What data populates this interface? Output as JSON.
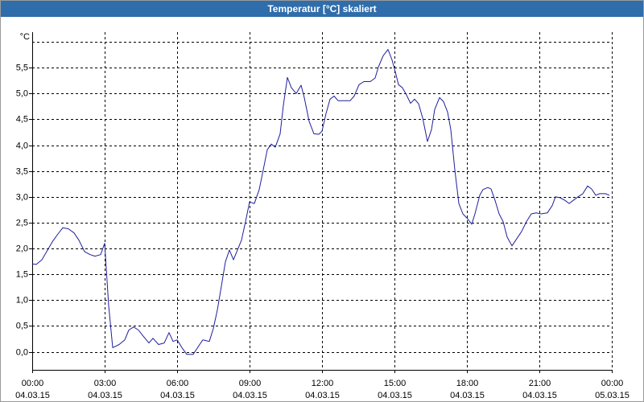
{
  "colors": {
    "title_bar": "#2f6dab",
    "title_text": "#ffffff",
    "series_line": "#1f1f9c",
    "grid": "#000000",
    "background": "#ffffff"
  },
  "chart_data": {
    "type": "line",
    "title": "Temperatur [°C] skaliert",
    "xlabel": "",
    "ylabel": "°C",
    "xlim": [
      "04.03.15 00:00",
      "05.03.15 00:00"
    ],
    "ylim": [
      -0.35,
      6.0
    ],
    "grid": true,
    "legend": "none",
    "yticks": [
      0.0,
      0.5,
      1.0,
      1.5,
      2.0,
      2.5,
      3.0,
      3.5,
      4.0,
      4.5,
      5.0,
      5.5
    ],
    "ytick_labels": [
      "0,0",
      "0,5",
      "1,0",
      "1,5",
      "2,0",
      "2,5",
      "3,0",
      "3,5",
      "4,0",
      "4,5",
      "5,0",
      "5,5"
    ],
    "xticks": [
      {
        "time": "00:00",
        "date": "04.03.15"
      },
      {
        "time": "03:00",
        "date": "04.03.15"
      },
      {
        "time": "06:00",
        "date": "04.03.15"
      },
      {
        "time": "09:00",
        "date": "04.03.15"
      },
      {
        "time": "12:00",
        "date": "04.03.15"
      },
      {
        "time": "15:00",
        "date": "04.03.15"
      },
      {
        "time": "18:00",
        "date": "04.03.15"
      },
      {
        "time": "21:00",
        "date": "04.03.15"
      },
      {
        "time": "00:00",
        "date": "05.03.15"
      }
    ],
    "series": [
      {
        "x": [
          "04.03.15 00:00",
          "04.03.15 00:10",
          "04.03.15 00:24",
          "04.03.15 00:36",
          "04.03.15 00:50",
          "04.03.15 01:04",
          "04.03.15 01:16",
          "04.03.15 01:30",
          "04.03.15 01:44",
          "04.03.15 01:56",
          "04.03.15 02:10",
          "04.03.15 02:24",
          "04.03.15 02:36",
          "04.03.15 02:50",
          "04.03.15 03:00",
          "04.03.15 03:10",
          "04.03.15 03:20",
          "04.03.15 03:36",
          "04.03.15 03:50",
          "04.03.15 04:00",
          "04.03.15 04:12",
          "04.03.15 04:24",
          "04.03.15 04:36",
          "04.03.15 04:50",
          "04.03.15 05:00",
          "04.03.15 05:14",
          "04.03.15 05:28",
          "04.03.15 05:40",
          "04.03.15 05:50",
          "04.03.15 06:00",
          "04.03.15 06:12",
          "04.03.15 06:24",
          "04.03.15 06:40",
          "04.03.15 06:56",
          "04.03.15 07:04",
          "04.03.15 07:20",
          "04.03.15 07:30",
          "04.03.15 07:40",
          "04.03.15 07:50",
          "04.03.15 08:00",
          "04.03.15 08:10",
          "04.03.15 08:20",
          "04.03.15 08:30",
          "04.03.15 08:40",
          "04.03.15 08:50",
          "04.03.15 09:00",
          "04.03.15 09:12",
          "04.03.15 09:24",
          "04.03.15 09:34",
          "04.03.15 09:44",
          "04.03.15 09:54",
          "04.03.15 10:04",
          "04.03.15 10:16",
          "04.03.15 10:24",
          "04.03.15 10:34",
          "04.03.15 10:44",
          "04.03.15 10:56",
          "04.03.15 11:08",
          "04.03.15 11:16",
          "04.03.15 11:28",
          "04.03.15 11:40",
          "04.03.15 11:52",
          "04.03.15 12:00",
          "04.03.15 12:10",
          "04.03.15 12:20",
          "04.03.15 12:30",
          "04.03.15 12:40",
          "04.03.15 12:56",
          "04.03.15 13:10",
          "04.03.15 13:20",
          "04.03.15 13:32",
          "04.03.15 13:44",
          "04.03.15 14:00",
          "04.03.15 14:12",
          "04.03.15 14:20",
          "04.03.15 14:32",
          "04.03.15 14:44",
          "04.03.15 14:54",
          "04.03.15 15:04",
          "04.03.15 15:10",
          "04.03.15 15:20",
          "04.03.15 15:30",
          "04.03.15 15:40",
          "04.03.15 15:50",
          "04.03.15 16:00",
          "04.03.15 16:10",
          "04.03.15 16:22",
          "04.03.15 16:32",
          "04.03.15 16:40",
          "04.03.15 16:52",
          "04.03.15 17:02",
          "04.03.15 17:12",
          "04.03.15 17:20",
          "04.03.15 17:30",
          "04.03.15 17:40",
          "04.03.15 17:50",
          "04.03.15 18:00",
          "04.03.15 18:12",
          "04.03.15 18:20",
          "04.03.15 18:32",
          "04.03.15 18:40",
          "04.03.15 18:52",
          "04.03.15 19:00",
          "04.03.15 19:10",
          "04.03.15 19:20",
          "04.03.15 19:30",
          "04.03.15 19:40",
          "04.03.15 19:52",
          "04.03.15 20:04",
          "04.03.15 20:16",
          "04.03.15 20:28",
          "04.03.15 20:40",
          "04.03.15 20:52",
          "04.03.15 21:04",
          "04.03.15 21:20",
          "04.03.15 21:32",
          "04.03.15 21:40",
          "04.03.15 21:52",
          "04.03.15 22:04",
          "04.03.15 22:14",
          "04.03.15 22:24",
          "04.03.15 22:36",
          "04.03.15 22:48",
          "04.03.15 23:00",
          "04.03.15 23:10",
          "04.03.15 23:20",
          "04.03.15 23:30",
          "04.03.15 23:44",
          "04.03.15 23:54"
        ],
        "y": [
          1.7,
          1.69,
          1.78,
          1.94,
          2.13,
          2.28,
          2.4,
          2.38,
          2.3,
          2.16,
          1.94,
          1.88,
          1.85,
          1.88,
          2.1,
          0.89,
          0.08,
          0.14,
          0.23,
          0.42,
          0.48,
          0.42,
          0.3,
          0.17,
          0.26,
          0.14,
          0.17,
          0.37,
          0.2,
          0.23,
          0.08,
          -0.05,
          -0.05,
          0.14,
          0.23,
          0.2,
          0.45,
          0.81,
          1.27,
          1.74,
          1.97,
          1.78,
          1.97,
          2.16,
          2.52,
          2.9,
          2.87,
          3.14,
          3.52,
          3.91,
          4.02,
          3.96,
          4.22,
          4.77,
          5.31,
          5.11,
          5.0,
          5.16,
          4.92,
          4.46,
          4.22,
          4.21,
          4.27,
          4.61,
          4.89,
          4.95,
          4.86,
          4.86,
          4.86,
          4.95,
          5.17,
          5.23,
          5.23,
          5.3,
          5.51,
          5.73,
          5.85,
          5.65,
          5.36,
          5.17,
          5.11,
          4.97,
          4.81,
          4.89,
          4.8,
          4.53,
          4.07,
          4.3,
          4.69,
          4.92,
          4.84,
          4.64,
          4.3,
          3.52,
          2.87,
          2.67,
          2.59,
          2.47,
          2.67,
          3.03,
          3.14,
          3.18,
          3.15,
          2.93,
          2.67,
          2.52,
          2.22,
          2.05,
          2.19,
          2.33,
          2.52,
          2.67,
          2.69,
          2.67,
          2.69,
          2.83,
          3.0,
          2.98,
          2.93,
          2.87,
          2.93,
          3.0,
          3.06,
          3.21,
          3.15,
          3.03,
          3.06,
          3.06,
          3.03
        ]
      }
    ]
  }
}
